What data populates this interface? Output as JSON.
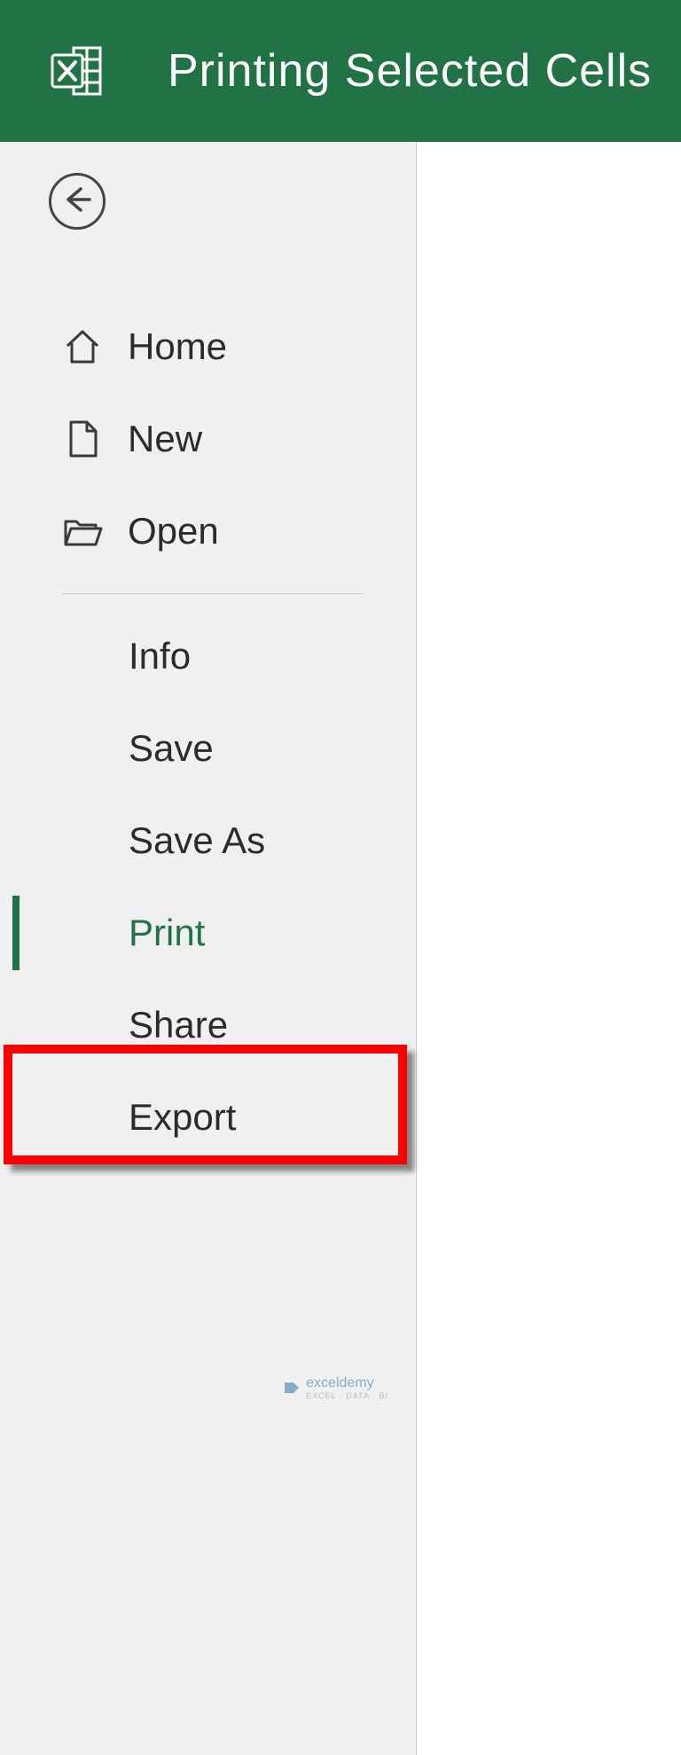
{
  "header": {
    "title": "Printing Selected Cells"
  },
  "sidebar": {
    "items_with_icon": [
      {
        "label": "Home"
      },
      {
        "label": "New"
      },
      {
        "label": "Open"
      }
    ],
    "items_no_icon": [
      {
        "label": "Info"
      },
      {
        "label": "Save"
      },
      {
        "label": "Save As"
      },
      {
        "label": "Print",
        "selected": true
      },
      {
        "label": "Share"
      },
      {
        "label": "Export"
      }
    ]
  },
  "watermark": {
    "brand": "exceldemy",
    "tagline": "EXCEL · DATA · BI"
  },
  "colors": {
    "accent": "#217346",
    "highlight": "#ff0000"
  }
}
